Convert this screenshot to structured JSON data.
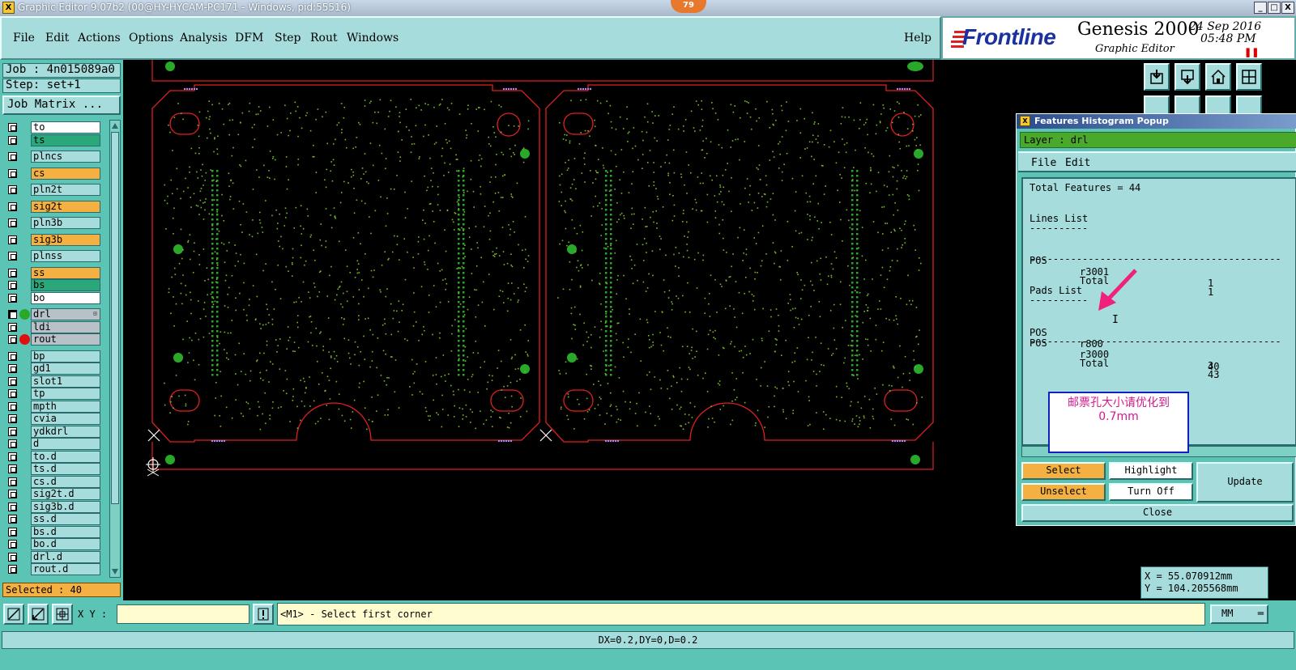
{
  "window": {
    "title": "Graphic Editor 9.07b2 (00@HY-HYCAM-PC171 - Windows, pid:55516)",
    "badge": "79",
    "controls": [
      "_",
      "□",
      "X"
    ]
  },
  "menu": [
    "File",
    "Edit",
    "Actions",
    "Options",
    "Analysis",
    "DFM",
    "Step",
    "Rout",
    "Windows"
  ],
  "help": "Help",
  "brand": {
    "logo": "Frontline",
    "product": "Genesis 2000",
    "module": "Graphic Editor",
    "date": "24 Sep 2016",
    "time": "05:48 PM",
    "pause": "❚❚"
  },
  "job": {
    "job_label": "Job : 4n015089a0",
    "step_label": "Step: set+1",
    "matrix_button": "Job Matrix ..."
  },
  "layers": [
    {
      "name": "to",
      "color": "#ffffff"
    },
    {
      "name": "ts",
      "color": "#2aa87a"
    },
    {
      "gap": true
    },
    {
      "name": "plncs",
      "color": "#a6dcdc"
    },
    {
      "gap": true
    },
    {
      "name": "cs",
      "color": "#f4b040"
    },
    {
      "gap": true
    },
    {
      "name": "pln2t",
      "color": "#a6dcdc"
    },
    {
      "gap": true
    },
    {
      "name": "sig2t",
      "color": "#f4b040"
    },
    {
      "gap": true
    },
    {
      "name": "pln3b",
      "color": "#a6dcdc"
    },
    {
      "gap": true
    },
    {
      "name": "sig3b",
      "color": "#f4b040"
    },
    {
      "gap": true
    },
    {
      "name": "plnss",
      "color": "#a6dcdc"
    },
    {
      "gap": true
    },
    {
      "name": "ss",
      "color": "#f4b040"
    },
    {
      "name": "bs",
      "color": "#2aa87a"
    },
    {
      "name": "bo",
      "color": "#ffffff"
    },
    {
      "gap": true
    },
    {
      "name": "drl",
      "color": "#b8c0c8",
      "active": true,
      "indicator": "#2aa82a",
      "mark": "⊞"
    },
    {
      "name": "ldi",
      "color": "#b8c0c8"
    },
    {
      "name": "rout",
      "color": "#b8c0c8",
      "indicator": "#e01010"
    },
    {
      "gap": true
    },
    {
      "name": "bp",
      "color": "#a6dcdc"
    },
    {
      "name": "gd1",
      "color": "#a6dcdc"
    },
    {
      "name": "slot1",
      "color": "#a6dcdc"
    },
    {
      "name": "tp",
      "color": "#a6dcdc"
    },
    {
      "name": "mpth",
      "color": "#a6dcdc"
    },
    {
      "name": "cvia",
      "color": "#a6dcdc"
    },
    {
      "name": "ydkdrl",
      "color": "#a6dcdc"
    },
    {
      "name": "d",
      "color": "#a6dcdc"
    },
    {
      "name": "to.d",
      "color": "#a6dcdc"
    },
    {
      "name": "ts.d",
      "color": "#a6dcdc"
    },
    {
      "name": "cs.d",
      "color": "#a6dcdc"
    },
    {
      "name": "sig2t.d",
      "color": "#a6dcdc"
    },
    {
      "name": "sig3b.d",
      "color": "#a6dcdc"
    },
    {
      "name": "ss.d",
      "color": "#a6dcdc"
    },
    {
      "name": "bs.d",
      "color": "#a6dcdc"
    },
    {
      "name": "bo.d",
      "color": "#a6dcdc"
    },
    {
      "name": "drl.d",
      "color": "#a6dcdc"
    },
    {
      "name": "rout.d",
      "color": "#a6dcdc"
    }
  ],
  "selected": "Selected : 40",
  "coords": {
    "x": "X = 55.070912mm",
    "y": "Y = 104.205568mm"
  },
  "popup": {
    "title": "Features Histogram Popup",
    "layer": "Layer :  drl",
    "menu": [
      "File",
      "Edit"
    ],
    "total_features": "Total Features = 44",
    "lines_header": "Lines List",
    "pads_header": "Pads List",
    "underline": "----------",
    "separator": "-------------------------------------------",
    "lines": [
      {
        "pol": "POS",
        "sym": "r3001",
        "count": "1"
      }
    ],
    "lines_total": {
      "label": "Total",
      "count": "1"
    },
    "pads": [
      {
        "pol": "POS",
        "sym": "r800",
        "count": "40"
      },
      {
        "pol": "POS",
        "sym": "r3000",
        "count": "3"
      }
    ],
    "pads_total": {
      "label": "Total",
      "count": "43"
    },
    "buttons": {
      "select": "Select",
      "highlight": "Highlight",
      "update": "Update",
      "unselect": "Unselect",
      "turn_off": "Turn Off",
      "close": "Close"
    }
  },
  "annotation": {
    "note": "邮票孔大小请优化到0.7mm",
    "arrow_color": "#f0207c"
  },
  "command": {
    "xy_label": "X Y :",
    "xy_value": "",
    "prompt": "<M1> - Select first corner",
    "unit": "MM"
  },
  "status": "DX=0.2,DY=0,D=0.2",
  "colors": {
    "outline": "#e02020",
    "drill": "#7ab82a",
    "tooling_hole": "#2aa82a",
    "panel_bg": "#a6dcdc",
    "accent_orange": "#f4b040"
  },
  "icons": [
    "close-icon",
    "maximize-icon",
    "minimize-icon",
    "zoom-icon",
    "measure-icon",
    "grid-icon",
    "home-icon",
    "import-icon",
    "export-icon",
    "layout-icon",
    "alert-icon"
  ]
}
